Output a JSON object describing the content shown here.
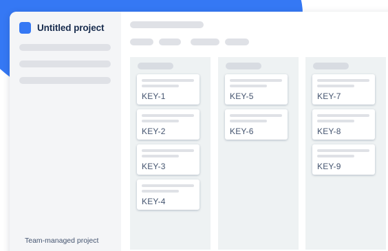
{
  "project": {
    "title": "Untitled project",
    "type_label": "Team-managed project"
  },
  "colors": {
    "accent": "#3578f4",
    "sidebar_bg": "#f4f5f7",
    "column_bg": "#eef2f3",
    "placeholder": "#dfe1e6",
    "text_dark": "#172b4d",
    "text_muted": "#44546f"
  },
  "board": {
    "columns": [
      {
        "cards": [
          {
            "key": "KEY-1"
          },
          {
            "key": "KEY-2"
          },
          {
            "key": "KEY-3"
          },
          {
            "key": "KEY-4"
          }
        ]
      },
      {
        "cards": [
          {
            "key": "KEY-5"
          },
          {
            "key": "KEY-6"
          }
        ]
      },
      {
        "cards": [
          {
            "key": "KEY-7"
          },
          {
            "key": "KEY-8"
          },
          {
            "key": "KEY-9"
          }
        ]
      }
    ]
  }
}
